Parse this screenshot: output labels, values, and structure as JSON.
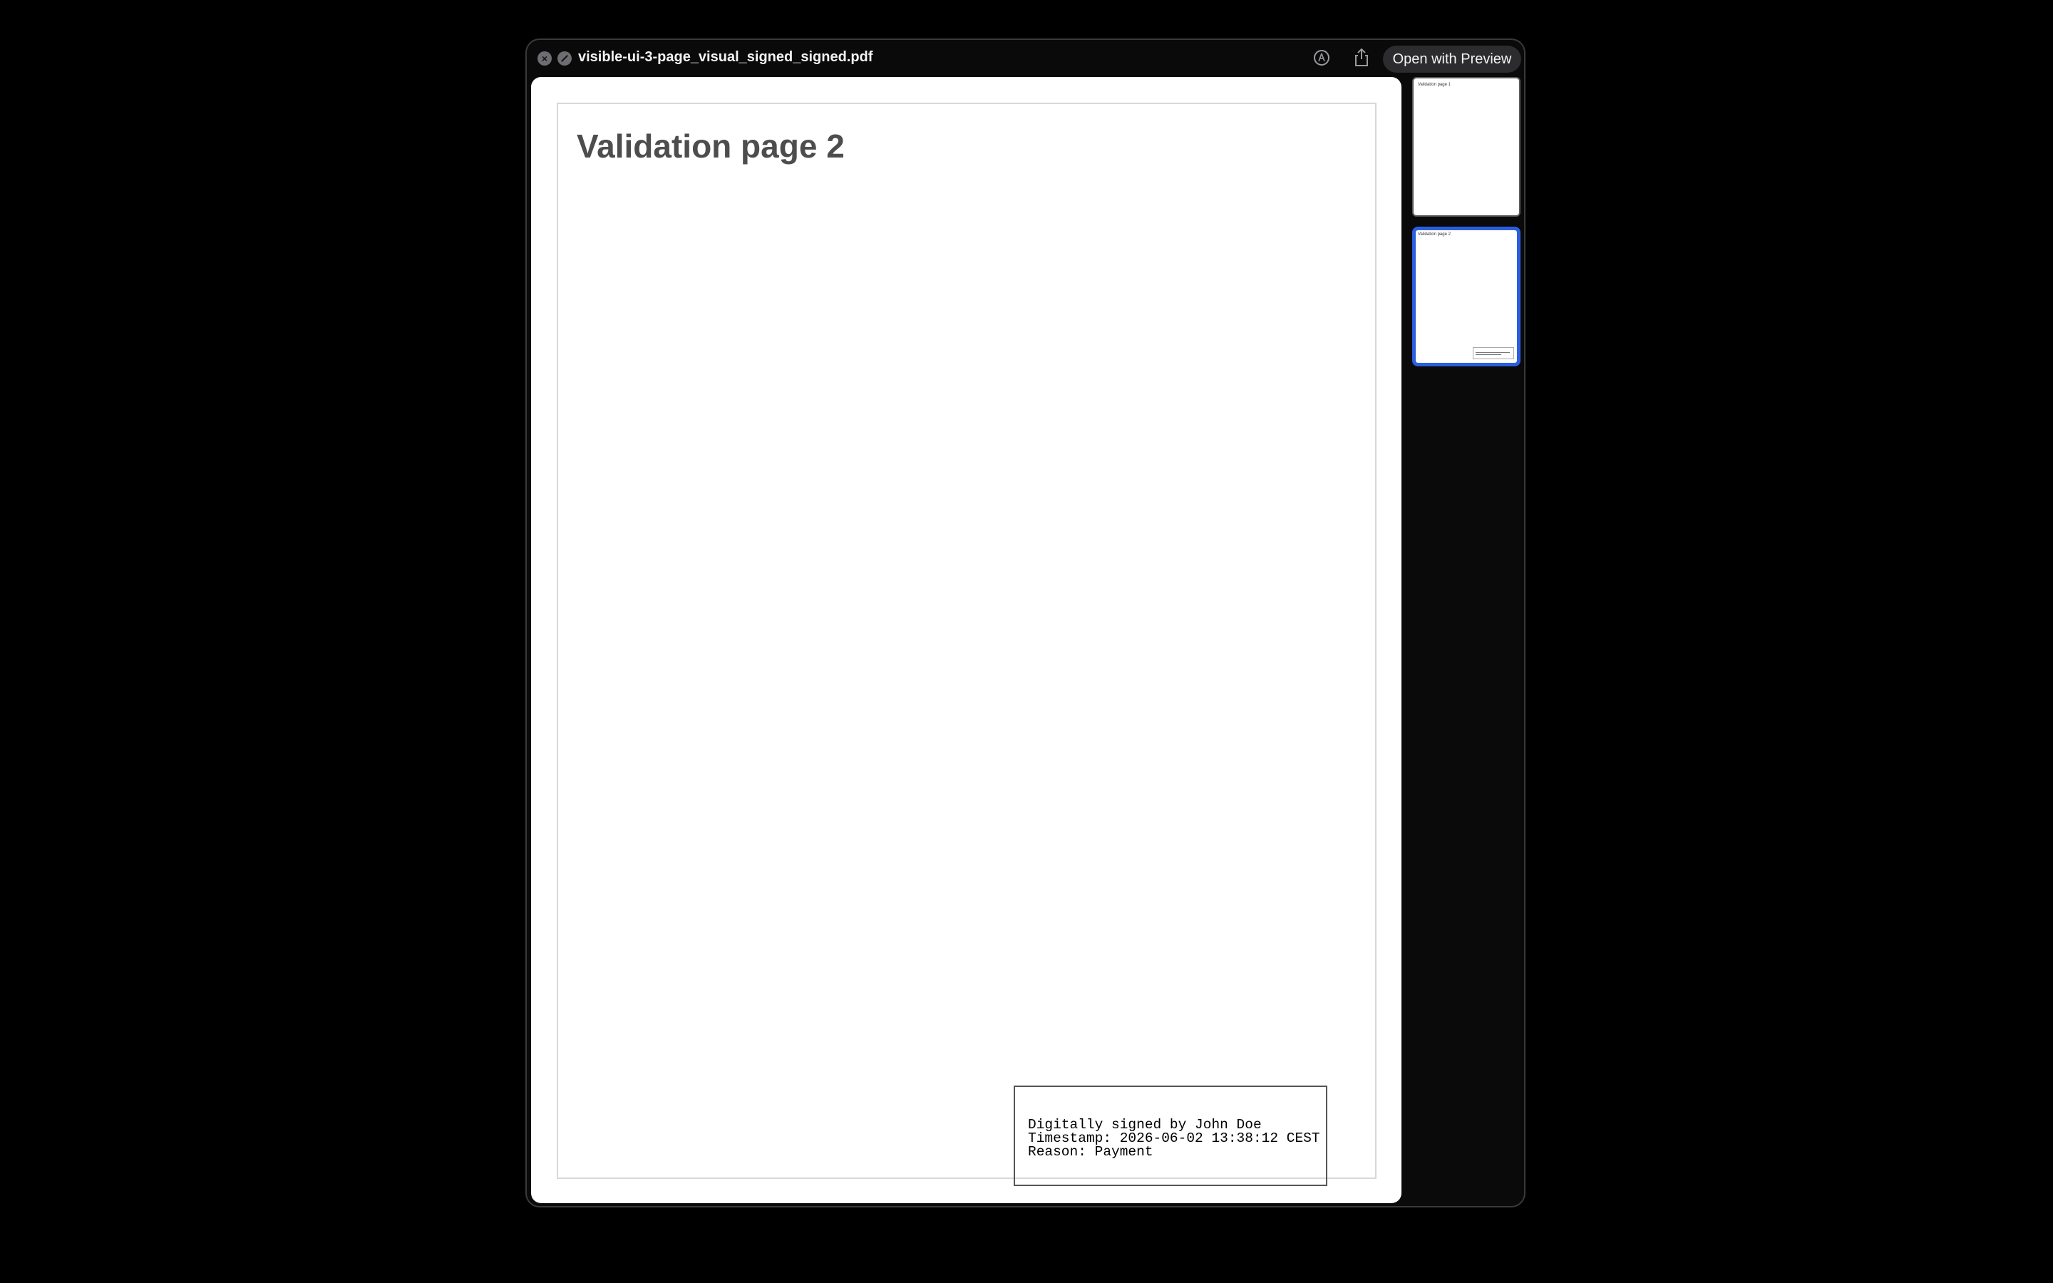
{
  "window": {
    "title": "visible-ui-3-page_visual_signed_signed.pdf",
    "open_button_label": "Open with Preview",
    "close_glyph": "×"
  },
  "icons": {
    "close": "close-circle-icon",
    "no_entry": "no-entry-icon",
    "markup": "markup-pen-icon",
    "share": "share-icon"
  },
  "document": {
    "heading": "Validation page 2",
    "signature": {
      "line1": "Digitally signed by John Doe",
      "line2": "Timestamp: 2026-06-02 13:38:12 CEST",
      "line3": "Reason: Payment"
    }
  },
  "sidebar": {
    "thumbnails": [
      {
        "label": "Validation page 1",
        "selected": false
      },
      {
        "label": "Validation page 2",
        "selected": true
      }
    ]
  },
  "colors": {
    "selected_thumbnail_border": "#2b5fe0",
    "window_background": "#0a0a0a"
  }
}
